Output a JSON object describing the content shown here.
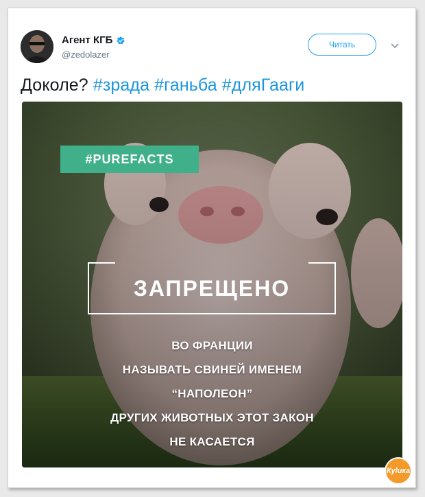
{
  "tweet": {
    "author_name": "Агент КГБ",
    "author_handle": "@zedolazer",
    "follow_label": "Читать",
    "text_plain": "Доколе?",
    "hashtags": [
      "#зрада",
      "#ганьба",
      "#дляГааги"
    ]
  },
  "image": {
    "tag": "#PUREFACTS",
    "headline": "ЗАПРЕЩЕНО",
    "lines": [
      "ВО ФРАНЦИИ",
      "НАЗЫВАТЬ СВИНЕЙ ИМЕНЕМ",
      "“НАПОЛЕОН”",
      "ДРУГИХ ЖИВОТНЫХ ЭТОТ ЗАКОН",
      "НЕ КАСАЕТСЯ"
    ]
  },
  "watermark": {
    "text": "Куlика"
  },
  "colors": {
    "accent": "#1da1f2",
    "hashtag": "#1b95e0",
    "tag_bg": "#3fb08a",
    "watermark": "#f39a2b"
  },
  "icons": {
    "verified": "verified-badge-icon",
    "chevron": "chevron-down-icon"
  }
}
